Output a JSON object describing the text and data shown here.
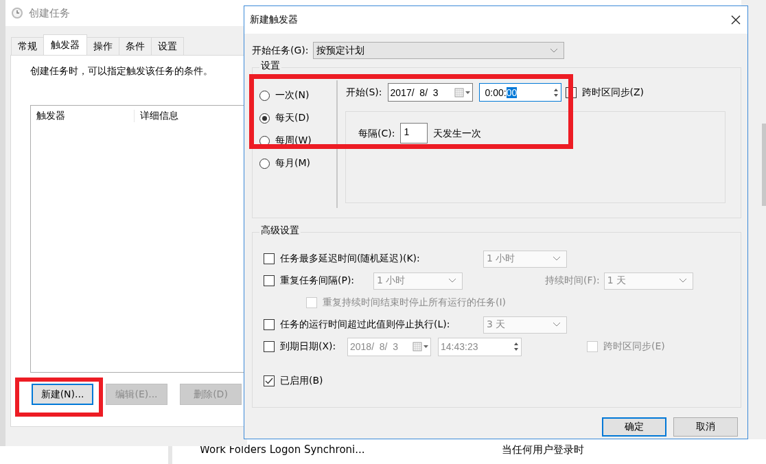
{
  "task_window": {
    "title": "创建任务",
    "tabs": [
      {
        "label": "常规",
        "selected": false
      },
      {
        "label": "触发器",
        "selected": true
      },
      {
        "label": "操作",
        "selected": false
      },
      {
        "label": "条件",
        "selected": false
      },
      {
        "label": "设置",
        "selected": false
      }
    ],
    "description": "创建任务时，可以指定触发该任务的条件。",
    "columns": [
      "触发器",
      "详细信息"
    ],
    "buttons": [
      {
        "label": "新建(N)...",
        "disabled": false,
        "focused": true
      },
      {
        "label": "编辑(E)...",
        "disabled": true,
        "focused": false
      },
      {
        "label": "删除(D)",
        "disabled": true,
        "focused": false
      }
    ]
  },
  "background_list": {
    "rows": [
      {
        "name": "Work Folders Logon Synchroni...",
        "trigger": "当任何用户登录时"
      }
    ]
  },
  "dialog": {
    "title": "新建触发器",
    "begin_task": {
      "label": "开始任务(G):",
      "value": "按预定计划"
    },
    "settings": {
      "title": "设置",
      "schedule": [
        {
          "label": "一次(N)",
          "selected": false
        },
        {
          "label": "每天(D)",
          "selected": true
        },
        {
          "label": "每周(W)",
          "selected": false
        },
        {
          "label": "每月(M)",
          "selected": false
        }
      ],
      "start": {
        "label": "开始(S):",
        "date": "2017/  8/  3",
        "time": "0:00:",
        "time_selection": "00"
      },
      "sync": {
        "label": "跨时区同步(Z)",
        "checked": false
      },
      "recur": {
        "label": "每隔(C):",
        "value": "1",
        "unit": "天发生一次"
      }
    },
    "advanced": {
      "title": "高级设置",
      "delay": {
        "label": "任务最多延迟时间(随机延迟)(K):",
        "checked": false,
        "value": "1 小时"
      },
      "repeat": {
        "label": "重复任务间隔(P):",
        "checked": false,
        "value": "1 小时",
        "duration_label": "持续时间(F):",
        "duration": "1 天"
      },
      "stop_at_end": {
        "label": "重复持续时间结束时停止所有运行的任务(I)",
        "checked": false
      },
      "stop_after": {
        "label": "任务的运行时间超过此值则停止执行(L):",
        "checked": false,
        "value": "3 天"
      },
      "expire": {
        "label": "到期日期(X):",
        "checked": false,
        "date": "2018/  8/  3",
        "time": "14:43:23",
        "sync_label": "跨时区同步(E)",
        "sync_checked": false
      },
      "enabled": {
        "label": "已启用(B)",
        "checked": true
      }
    },
    "buttons": [
      {
        "label": "确定",
        "default": true
      },
      {
        "label": "取消",
        "default": false
      }
    ]
  }
}
